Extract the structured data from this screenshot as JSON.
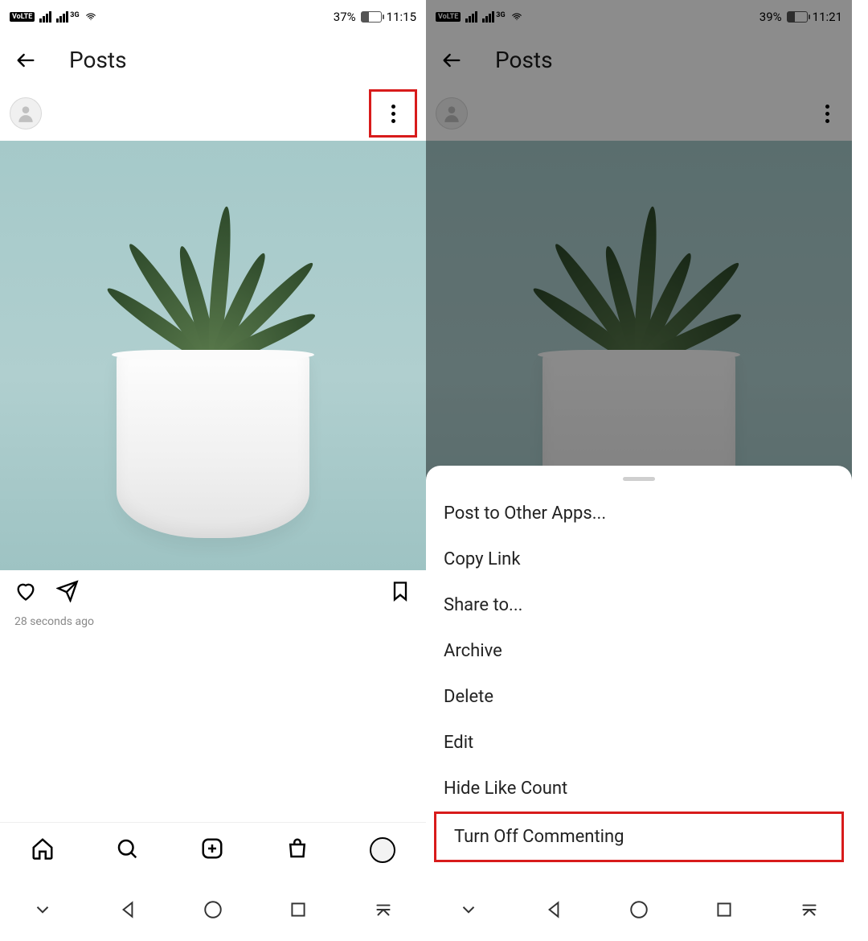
{
  "left": {
    "status": {
      "battery": "37%",
      "time": "11:15",
      "net_label": "3G",
      "volte": "VoLTE"
    },
    "header": {
      "title": "Posts"
    },
    "post": {
      "timestamp": "28 seconds ago"
    }
  },
  "right": {
    "status": {
      "battery": "39%",
      "time": "11:21",
      "net_label": "3G",
      "volte": "VoLTE"
    },
    "header": {
      "title": "Posts"
    },
    "sheet": {
      "items": [
        "Post to Other Apps...",
        "Copy Link",
        "Share to...",
        "Archive",
        "Delete",
        "Edit",
        "Hide Like Count",
        "Turn Off Commenting"
      ]
    }
  },
  "icons": {
    "back": "back-arrow-icon",
    "more": "more-icon",
    "heart": "heart-icon",
    "send": "send-icon",
    "save": "bookmark-icon",
    "home": "home-icon",
    "search": "search-icon",
    "add": "add-icon",
    "shop": "shop-icon",
    "profile": "profile-icon"
  }
}
